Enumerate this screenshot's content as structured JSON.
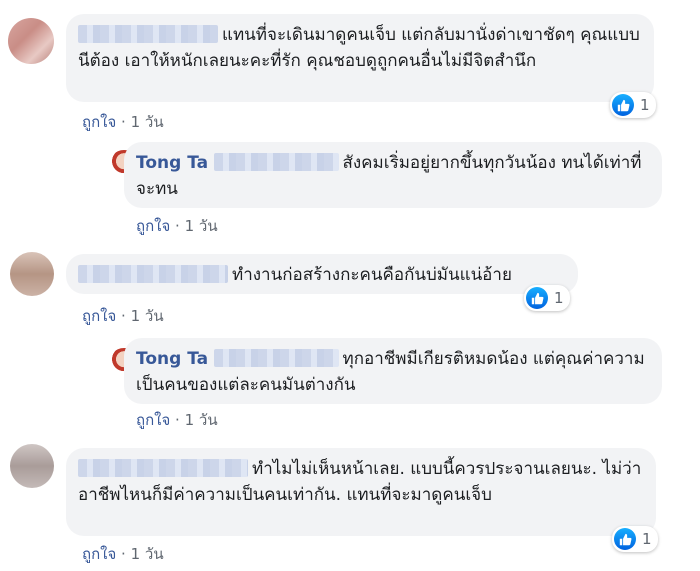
{
  "comments": [
    {
      "author": "",
      "text": "แทนที่จะเดินมาดูคนเจ็บ แต่กลับมานั่งด่าเขาชัดๆ คุณแบบนีต้อง เอาให้หนักเลยนะคะที่รัก คุณชอบดูถูกคนอื่นไม่มีจิตสำนึก",
      "like_label": "ถูกใจ",
      "time": "1 วัน",
      "reaction_count": "1"
    },
    {
      "author": "Tong Ta",
      "text": "สังคมเริ่มอยู่ยากขึ้นทุกวันน้อง ทนได้เท่าที่จะทน",
      "like_label": "ถูกใจ",
      "time": "1 วัน"
    },
    {
      "author": "",
      "text": "ทำงานก่อสร้างกะคนคือกันบ่มันแน่อ้าย",
      "like_label": "ถูกใจ",
      "time": "1 วัน",
      "reaction_count": "1"
    },
    {
      "author": "Tong Ta",
      "text": "ทุกอาชีพมีเกียรติหมดน้อง แต่คุณค่าความเป็นคนของแต่ละคนมันต่างกัน",
      "like_label": "ถูกใจ",
      "time": "1 วัน"
    },
    {
      "author": "",
      "text": "ทำไมไม่เห็นหน้าเลย. แบบนี้ควรประจานเลยนะ. ไม่ว่าอาชีพไหนก็มีค่าความเป็นคนเท่ากัน. แทนที่จะมาดูคนเจ็บ",
      "like_label": "ถูกใจ",
      "time": "1 วัน",
      "reaction_count": "1"
    }
  ],
  "separator": " · ",
  "colors": {
    "link": "#385898",
    "bubble": "#f2f3f5",
    "meta": "#606770",
    "like_blue": "#1877f2"
  },
  "icons": {
    "reaction": "thumbs-up-icon"
  }
}
